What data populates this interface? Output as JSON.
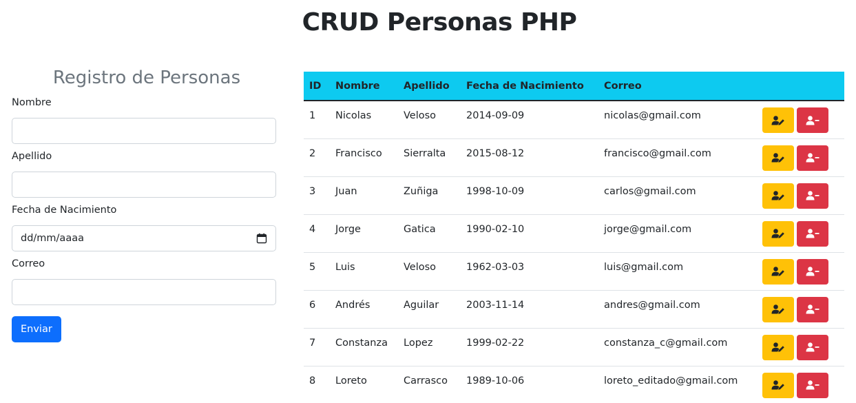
{
  "page": {
    "title": "CRUD Personas PHP"
  },
  "form": {
    "title": "Registro de Personas",
    "fields": [
      {
        "label": "Nombre",
        "value": ""
      },
      {
        "label": "Apellido",
        "value": ""
      },
      {
        "label": "Fecha de Nacimiento",
        "placeholder": "dd/mm/aaaa"
      },
      {
        "label": "Correo",
        "value": ""
      }
    ],
    "submit_label": "Enviar"
  },
  "table": {
    "headers": [
      "ID",
      "Nombre",
      "Apellido",
      "Fecha de Nacimiento",
      "Correo",
      ""
    ],
    "rows": [
      {
        "id": "1",
        "nombre": "Nicolas",
        "apellido": "Veloso",
        "fecha": "2014-09-09",
        "correo": "nicolas@gmail.com"
      },
      {
        "id": "2",
        "nombre": "Francisco",
        "apellido": "Sierralta",
        "fecha": "2015-08-12",
        "correo": "francisco@gmail.com"
      },
      {
        "id": "3",
        "nombre": "Juan",
        "apellido": "Zuñiga",
        "fecha": "1998-10-09",
        "correo": "carlos@gmail.com"
      },
      {
        "id": "4",
        "nombre": "Jorge",
        "apellido": "Gatica",
        "fecha": "1990-02-10",
        "correo": "jorge@gmail.com"
      },
      {
        "id": "5",
        "nombre": "Luis",
        "apellido": "Veloso",
        "fecha": "1962-03-03",
        "correo": "luis@gmail.com"
      },
      {
        "id": "6",
        "nombre": "Andrés",
        "apellido": "Aguilar",
        "fecha": "2003-11-14",
        "correo": "andres@gmail.com"
      },
      {
        "id": "7",
        "nombre": "Constanza",
        "apellido": "Lopez",
        "fecha": "1999-02-22",
        "correo": "constanza_c@gmail.com"
      },
      {
        "id": "8",
        "nombre": "Loreto",
        "apellido": "Carrasco",
        "fecha": "1989-10-06",
        "correo": "loreto_editado@gmail.com"
      }
    ],
    "actions": {
      "edit_icon": "user-edit-icon",
      "delete_icon": "user-minus-icon"
    }
  },
  "colors": {
    "header_bg": "#0dcaf0",
    "edit_button": "#ffc107",
    "delete_button": "#dc3545",
    "primary_button": "#0d6efd"
  }
}
